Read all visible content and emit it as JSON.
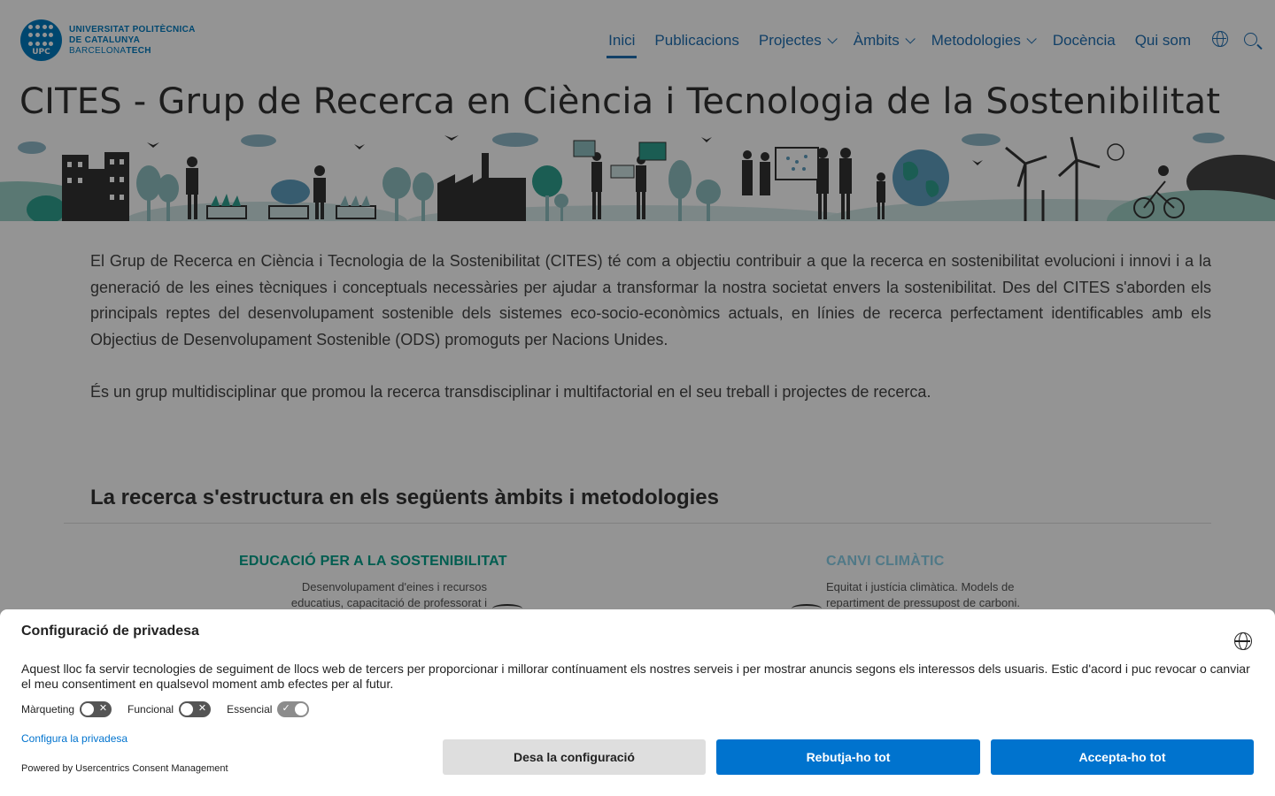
{
  "brand": {
    "logo_mark": "UPC",
    "line1": "UNIVERSITAT POLITÈCNICA",
    "line2": "DE CATALUNYA",
    "line3a": "BARCELONA",
    "line3b": "TECH"
  },
  "nav": {
    "items": [
      {
        "label": "Inici",
        "active": true,
        "dropdown": false
      },
      {
        "label": "Publicacions",
        "active": false,
        "dropdown": false
      },
      {
        "label": "Projectes",
        "active": false,
        "dropdown": true
      },
      {
        "label": "Àmbits",
        "active": false,
        "dropdown": true
      },
      {
        "label": "Metodologies",
        "active": false,
        "dropdown": true
      },
      {
        "label": "Docència",
        "active": false,
        "dropdown": false
      },
      {
        "label": "Qui som",
        "active": false,
        "dropdown": false
      }
    ],
    "icons": [
      "globe-icon",
      "search-icon"
    ]
  },
  "page": {
    "title": "CITES - Grup de Recerca en Ciència i Tecnologia de la Sostenibilitat",
    "intro": "El Grup de Recerca en Ciència i Tecnologia de la Sostenibilitat (CITES) té com a objectiu contribuir a que la recerca en sostenibilitat evolucioni i innovi i a la generació de les eines tècniques i conceptuals necessàries per ajudar a transformar la nostra societat envers la sostenibilitat. Des del CITES s'aborden els principals reptes del desenvolupament sostenible dels sistemes eco-socio-econòmics actuals, en línies de recerca perfectament identificables amb els Objectius de Desenvolupament Sostenible (ODS) promoguts per Nacions Unides.",
    "intro2": "És un grup multidisciplinar que promou la recerca transdisciplinar i multifactorial en el seu treball i projectes de recerca.",
    "section_title": "La recerca s'estructura en els següents àmbits i metodologies",
    "area_left": {
      "title": "EDUCACIÓ PER A LA SOSTENIBILITAT",
      "text": "Desenvolupament d'eines i recursos educatius, capacitació de professorat i"
    },
    "area_right": {
      "title": "CANVI CLIMÀTIC",
      "text": "Equitat i justícia climàtica. Models de repartiment de pressupost de carboni."
    }
  },
  "consent": {
    "title": "Configuració de privadesa",
    "text": "Aquest lloc fa servir tecnologies de seguiment de llocs web de tercers per proporcionar i millorar contínuament els nostres serveis i per mostrar anuncis segons els interessos dels usuaris. Estic d'acord i puc revocar o canviar el meu consentiment en qualsevol moment amb efectes per al futur.",
    "toggles": [
      {
        "label": "Màrqueting",
        "on": false
      },
      {
        "label": "Funcional",
        "on": false
      },
      {
        "label": "Essencial",
        "on": true
      }
    ],
    "configure_link": "Configura la privadesa",
    "powered_by": "Powered by Usercentrics Consent Management",
    "buttons": {
      "save": "Desa la configuració",
      "deny": "Rebutja-ho tot",
      "accept": "Accepta-ho tot"
    }
  },
  "colors": {
    "brand_blue": "#007bc0",
    "nav_blue": "#1f6fb2",
    "button_blue": "#0073ce",
    "teal": "#00a18a"
  }
}
